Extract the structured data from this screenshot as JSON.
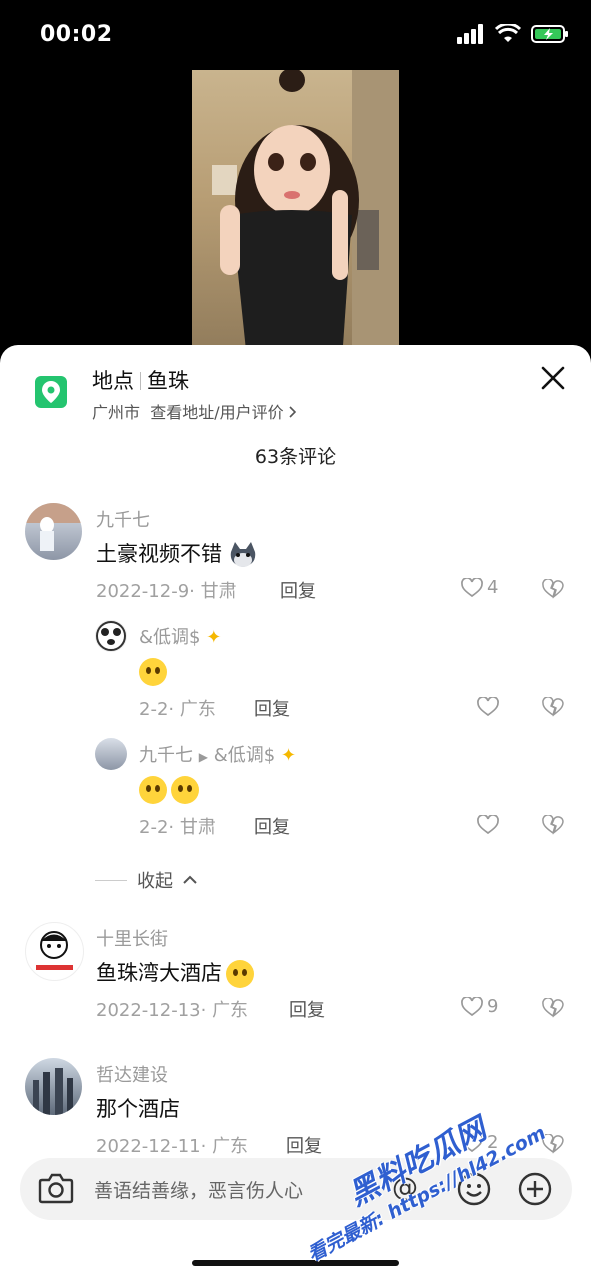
{
  "status": {
    "time": "00:02"
  },
  "location": {
    "label": "地点",
    "name": "鱼珠",
    "city": "广州市",
    "link": "查看地址/用户评价"
  },
  "comment_count": "63条评论",
  "comments": [
    {
      "user": "九千七",
      "text": "土豪视频不错",
      "date": "2022-12-9",
      "region": "甘肃",
      "reply_label": "回复",
      "likes": "4"
    },
    {
      "user": "&低调$",
      "text": "",
      "date": "2-2",
      "region": "广东",
      "reply_label": "回复",
      "likes": ""
    },
    {
      "user": "九千七",
      "reply_to": "&低调$",
      "text": "",
      "date": "2-2",
      "region": "甘肃",
      "reply_label": "回复",
      "likes": ""
    },
    {
      "user": "十里长街",
      "text": "鱼珠湾大酒店",
      "date": "2022-12-13",
      "region": "广东",
      "reply_label": "回复",
      "likes": "9"
    },
    {
      "user": "哲达建设",
      "text": "那个酒店",
      "date": "2022-12-11",
      "region": "广东",
      "reply_label": "回复",
      "likes": "2"
    }
  ],
  "collapse_label": "收起",
  "input": {
    "placeholder": "善语结善缘，恶言伤人心"
  },
  "watermark": {
    "line1": "黑料吃瓜网",
    "line2": "看完最新: https://hl42.com"
  },
  "icons": [
    "location-pin-icon",
    "close-icon",
    "heart-icon",
    "broken-heart-icon",
    "camera-icon",
    "at-icon",
    "smile-icon",
    "plus-icon",
    "chevron-up-icon",
    "signal-icon",
    "wifi-icon",
    "battery-icon"
  ],
  "colors": {
    "accent_green": "#24c46f",
    "watermark_blue": "#2f5fd0"
  }
}
